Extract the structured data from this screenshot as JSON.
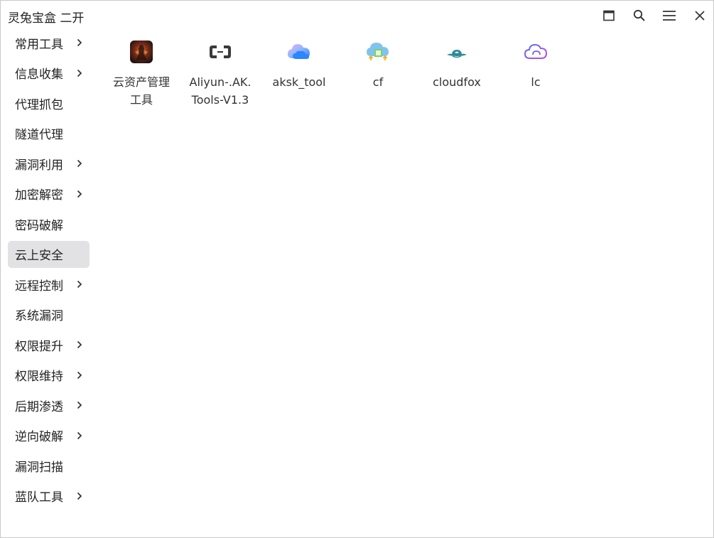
{
  "window": {
    "title": "灵兔宝盒 二开"
  },
  "titlebar_icons": [
    "maximize-icon",
    "search-icon",
    "menu-icon",
    "close-icon"
  ],
  "sidebar": {
    "items": [
      {
        "label": "常用工具",
        "has_submenu": true
      },
      {
        "label": "信息收集",
        "has_submenu": true
      },
      {
        "label": "代理抓包",
        "has_submenu": false
      },
      {
        "label": "隧道代理",
        "has_submenu": false
      },
      {
        "label": "漏洞利用",
        "has_submenu": true
      },
      {
        "label": "加密解密",
        "has_submenu": true
      },
      {
        "label": "密码破解",
        "has_submenu": false
      },
      {
        "label": "云上安全",
        "has_submenu": false,
        "selected": true
      },
      {
        "label": "远程控制",
        "has_submenu": true
      },
      {
        "label": "系统漏洞",
        "has_submenu": false
      },
      {
        "label": "权限提升",
        "has_submenu": true
      },
      {
        "label": "权限维持",
        "has_submenu": true
      },
      {
        "label": "后期渗透",
        "has_submenu": true
      },
      {
        "label": "逆向破解",
        "has_submenu": true
      },
      {
        "label": "漏洞扫描",
        "has_submenu": false
      },
      {
        "label": "蓝队工具",
        "has_submenu": true
      }
    ],
    "active_bg": "#e2e2e4"
  },
  "apps": [
    {
      "label": "云资产管理工具",
      "icon": "game-character-icon"
    },
    {
      "label": "Aliyun-.AK.Tools-V1.3",
      "icon": "aliyun-logo-icon"
    },
    {
      "label": "aksk_tool",
      "icon": "cloud-icon"
    },
    {
      "label": "cf",
      "icon": "cloud-upload-icon"
    },
    {
      "label": "cloudfox",
      "icon": "fox-cloud-icon"
    },
    {
      "label": "lc",
      "icon": "cloud-outline-icon"
    }
  ]
}
